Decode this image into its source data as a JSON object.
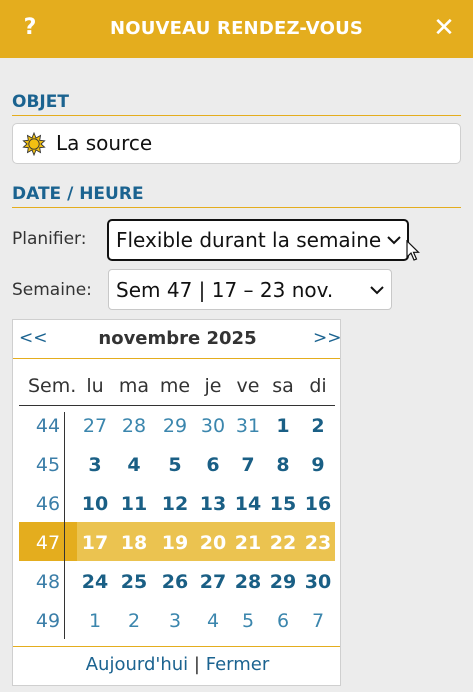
{
  "header": {
    "help_label": "?",
    "title": "NOUVEAU RENDEZ-VOUS",
    "close_label": "✕",
    "bg_color": "#e4ad1e"
  },
  "objet": {
    "section_title": "OBJET",
    "icon": "sun-icon",
    "value": "La source"
  },
  "datetime": {
    "section_title": "DATE / HEURE",
    "plan_label": "Planifier:",
    "plan_value": "Flexible durant la semaine",
    "week_label": "Semaine:",
    "week_value": "Sem 47 | 17 – 23 nov."
  },
  "calendar": {
    "prev_label": "<<",
    "next_label": ">>",
    "month_title": "novembre 2025",
    "week_header": "Sem.",
    "day_headers": [
      "lu",
      "ma",
      "me",
      "je",
      "ve",
      "sa",
      "di"
    ],
    "rows": [
      {
        "week": "44",
        "days": [
          "27",
          "28",
          "29",
          "30",
          "31",
          "1",
          "2"
        ]
      },
      {
        "week": "45",
        "days": [
          "3",
          "4",
          "5",
          "6",
          "7",
          "8",
          "9"
        ]
      },
      {
        "week": "46",
        "days": [
          "10",
          "11",
          "12",
          "13",
          "14",
          "15",
          "16"
        ]
      },
      {
        "week": "47",
        "days": [
          "17",
          "18",
          "19",
          "20",
          "21",
          "22",
          "23"
        ]
      },
      {
        "week": "48",
        "days": [
          "24",
          "25",
          "26",
          "27",
          "28",
          "29",
          "30"
        ]
      },
      {
        "week": "49",
        "days": [
          "1",
          "2",
          "3",
          "4",
          "5",
          "6",
          "7"
        ]
      }
    ],
    "selected_week": "47",
    "today_label": "Aujourd'hui",
    "separator": "|",
    "close_label": "Fermer",
    "accent_color": "#e4ad1e",
    "highlight_color": "#ebc350"
  }
}
